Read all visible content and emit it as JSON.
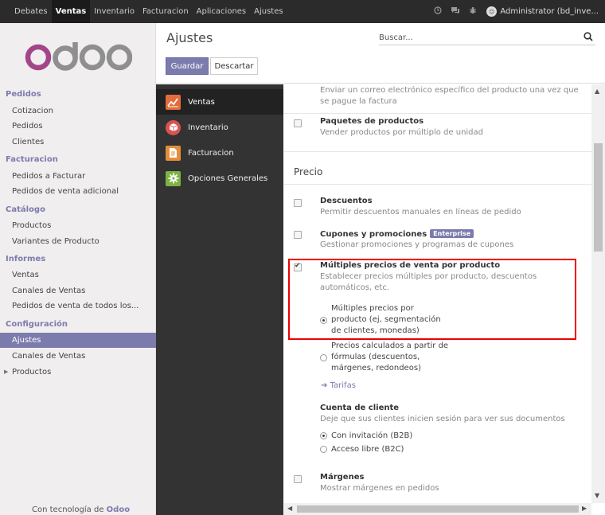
{
  "topbar": {
    "menu": [
      "Debates",
      "Ventas",
      "Inventario",
      "Facturacion",
      "Aplicaciones",
      "Ajustes"
    ],
    "active_menu": "Ventas",
    "user": "Administrator (bd_inve..."
  },
  "sidebar": {
    "logo_text": "odoo",
    "sections": [
      {
        "title": "Pedidos",
        "items": [
          "Cotizacion",
          "Pedidos",
          "Clientes"
        ]
      },
      {
        "title": "Facturacion",
        "items": [
          "Pedidos a Facturar",
          "Pedidos de venta adicional"
        ]
      },
      {
        "title": "Catálogo",
        "items": [
          "Productos",
          "Variantes de Producto"
        ]
      },
      {
        "title": "Informes",
        "items": [
          "Ventas",
          "Canales de Ventas",
          "Pedidos de venta de todos los..."
        ]
      },
      {
        "title": "Configuración",
        "items": [
          "Ajustes",
          "Canales de Ventas",
          "Productos"
        ]
      }
    ],
    "active_item": "Ajustes",
    "powered_prefix": "Con tecnología de",
    "powered_brand": "Odoo"
  },
  "control_panel": {
    "title": "Ajustes",
    "save_label": "Guardar",
    "discard_label": "Descartar",
    "search_placeholder": "Buscar..."
  },
  "apps": [
    {
      "label": "Ventas",
      "icon": "chart-icon",
      "color": "#e46b3b"
    },
    {
      "label": "Inventario",
      "icon": "box-icon",
      "color": "#d9534f"
    },
    {
      "label": "Facturacion",
      "icon": "invoice-icon",
      "color": "#e58e3a"
    },
    {
      "label": "Opciones Generales",
      "icon": "gear-icon",
      "color": "#7cb342"
    }
  ],
  "settings": {
    "email_desc": "Enviar un correo electrónico específico del producto una vez que se pague la factura",
    "paquetes": {
      "title": "Paquetes de productos",
      "desc": "Vender productos por múltiplo de unidad"
    },
    "precio_section": "Precio",
    "descuentos": {
      "title": "Descuentos",
      "desc": "Permitir descuentos manuales en líneas de pedido"
    },
    "cupones": {
      "title": "Cupones y promociones",
      "badge": "Enterprise",
      "desc": "Gestionar promociones y programas de cupones"
    },
    "multiples": {
      "title": "Múltiples precios de venta por producto",
      "desc": "Establecer precios múltiples por producto, descuentos automáticos, etc.",
      "option1": "Múltiples precios por producto (ej, segmentación de clientes, monedas)",
      "option2": "Precios calculados a partir de fórmulas (descuentos, márgenes, redondeos)",
      "link": "Tarifas"
    },
    "cuenta": {
      "title": "Cuenta de cliente",
      "desc": "Deje que sus clientes inicien sesión para ver sus documentos",
      "option1": "Con invitación (B2B)",
      "option2": "Acceso libre (B2C)"
    },
    "margenes": {
      "title": "Márgenes",
      "desc": "Mostrar márgenes en pedidos"
    }
  }
}
